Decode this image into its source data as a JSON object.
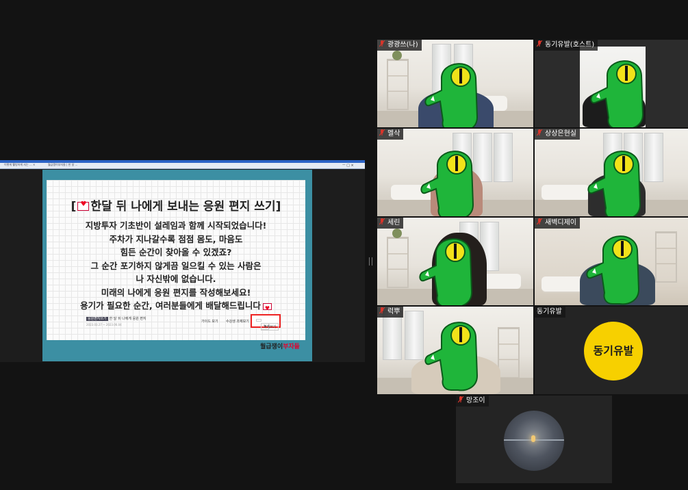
{
  "shared_screen": {
    "browser_tabs": [
      "이렇게 웰빙하게 사는 ... ×",
      "월급쟁이부자들 | 한 달 ..."
    ],
    "browser_controls": "ㅡ □ ×",
    "card": {
      "title": "한달 뒤 나에게 보내는 응원 편지 쓰기",
      "title_open": "[",
      "title_close": "]",
      "lines": [
        "지방투자 기초반이 설레임과 함께 시작되었습니다!",
        "주차가 지나갈수록 점점 몸도, 마음도",
        "힘든 순간이 찾아올 수 있겠죠?",
        "그 순간 포기하지 않게끔 일으킬 수 있는 사람은",
        "나 자신밖에 없습니다.",
        "미래의 나에게 응원 편지를 작성해보세요!",
        "용기가 필요한 순간, 여러분들에게 배달해드립니다"
      ],
      "mini_tag": "응원편지쓰기",
      "mini_title": "한 달 뒤 나에게 응원 편지",
      "mini_date": "2023.03.27 ~ 2023.06.04",
      "button_1": "가이드 보기",
      "button_2": "수강생 과제보기",
      "write_button": "과제쓰기",
      "brand_a": "월급쟁이",
      "brand_b": "부자들"
    }
  },
  "participants": [
    {
      "name": "광광쓰(나)",
      "video": "room"
    },
    {
      "name": "동기유발(호스트)",
      "video": "room-dark"
    },
    {
      "name": "멜삭",
      "video": "room"
    },
    {
      "name": "상상은현실",
      "video": "room"
    },
    {
      "name": "세린",
      "video": "room"
    },
    {
      "name": "새벽디제이",
      "video": "room"
    },
    {
      "name": "럭뿌",
      "video": "room"
    },
    {
      "name": "동기유발",
      "video": "avatar",
      "avatar_text": "동기유발"
    },
    {
      "name": "망조이",
      "video": "photo-avatar"
    }
  ],
  "colors": {
    "mascot_green": "#1fb53a",
    "mascot_eye": "#f2e21a",
    "avatar_yellow": "#f7d000",
    "highlight_red": "#e22222",
    "frame_teal": "#3c8fa3",
    "mic_red": "#d9352b"
  },
  "icons": {
    "mic": "mic-muted-icon",
    "letter": "love-letter-icon",
    "pencil": "pencil-icon"
  }
}
